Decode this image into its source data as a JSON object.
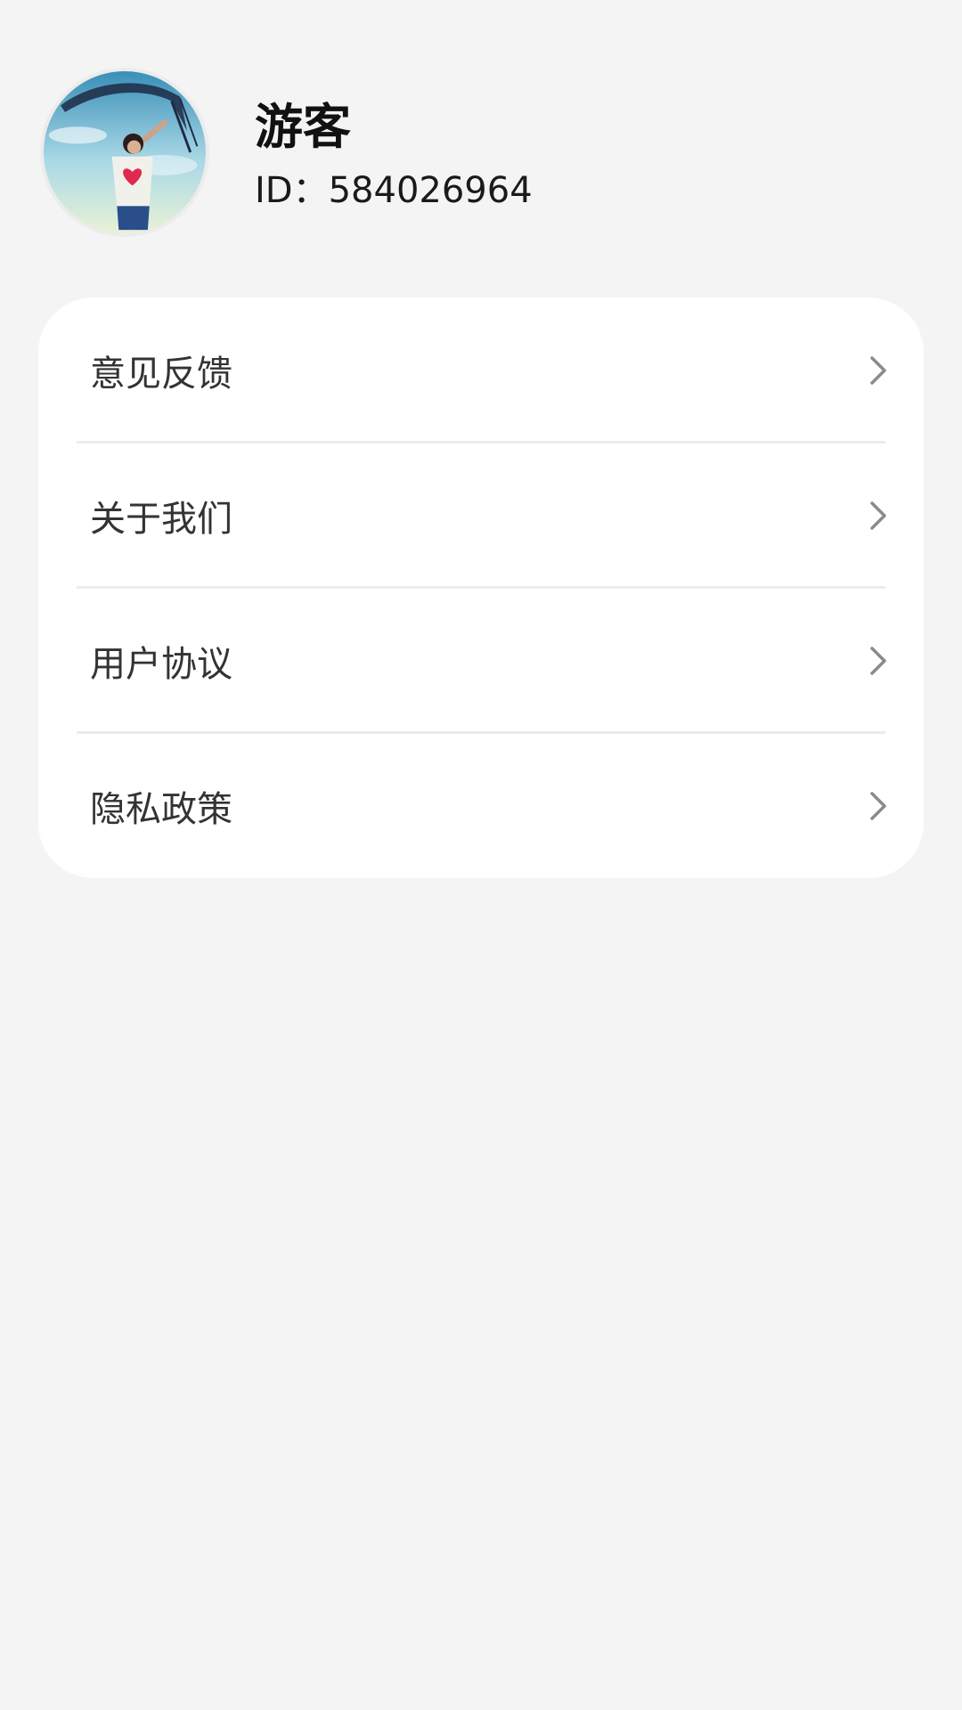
{
  "profile": {
    "name": "游客",
    "id_text": "ID：584026964",
    "avatar": "user-avatar-photo"
  },
  "menu": {
    "items": [
      {
        "label": "意见反馈",
        "icon": "chevron-right-icon"
      },
      {
        "label": "关于我们",
        "icon": "chevron-right-icon"
      },
      {
        "label": "用户协议",
        "icon": "chevron-right-icon"
      },
      {
        "label": "隐私政策",
        "icon": "chevron-right-icon"
      }
    ]
  },
  "colors": {
    "background": "#f4f4f4",
    "card": "#ffffff",
    "divider": "#ececec",
    "label_text": "#333333",
    "chevron": "#8a8a8a"
  }
}
